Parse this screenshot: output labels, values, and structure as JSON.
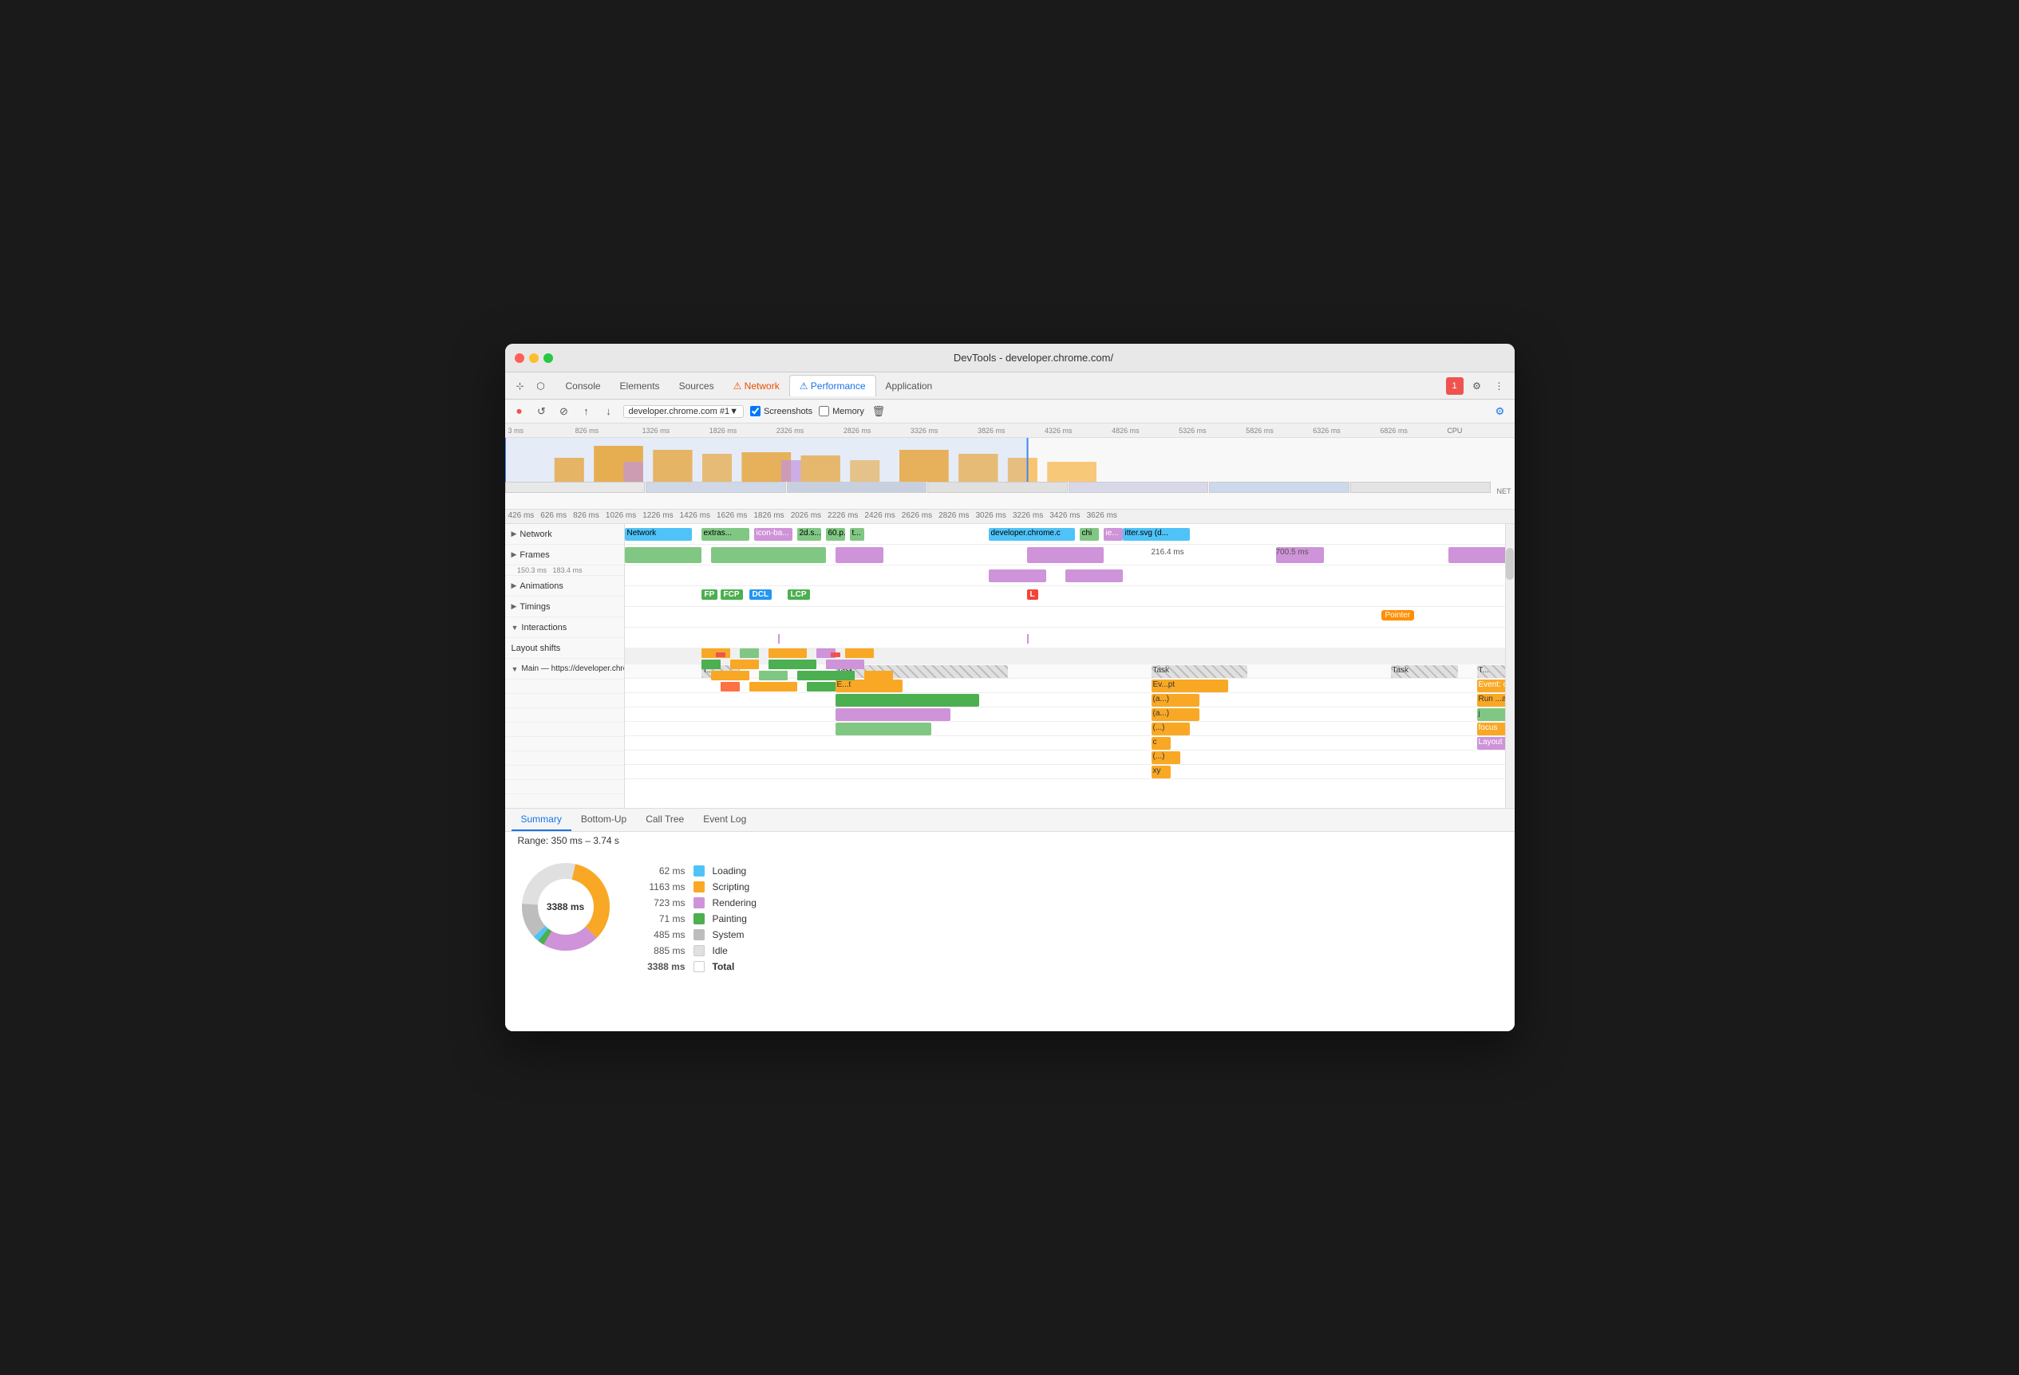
{
  "window": {
    "title": "DevTools - developer.chrome.com/"
  },
  "titlebar": {
    "traffic_lights": [
      "red",
      "yellow",
      "green"
    ]
  },
  "tabs": [
    {
      "label": "Console",
      "active": false,
      "warning": false
    },
    {
      "label": "Elements",
      "active": false,
      "warning": false
    },
    {
      "label": "Sources",
      "active": false,
      "warning": false
    },
    {
      "label": "⚠ Network",
      "active": false,
      "warning": true
    },
    {
      "label": "⚠ Performance",
      "active": true,
      "warning": true
    },
    {
      "label": "Application",
      "active": false,
      "warning": false
    }
  ],
  "toolbar": {
    "url": "developer.chrome.com #1▼",
    "screenshots_label": "Screenshots",
    "memory_label": "Memory"
  },
  "summary": {
    "range": "Range: 350 ms – 3.74 s",
    "total_ms": "3388 ms",
    "tabs": [
      "Summary",
      "Bottom-Up",
      "Call Tree",
      "Event Log"
    ],
    "active_tab": "Summary",
    "stats": [
      {
        "value": "62 ms",
        "label": "Loading",
        "color": "#4fc3f7"
      },
      {
        "value": "1163 ms",
        "label": "Scripting",
        "color": "#f9a825"
      },
      {
        "value": "723 ms",
        "label": "Rendering",
        "color": "#ce93d8"
      },
      {
        "value": "71 ms",
        "label": "Painting",
        "color": "#4caf50"
      },
      {
        "value": "485 ms",
        "label": "System",
        "color": "#bdbdbd"
      },
      {
        "value": "885 ms",
        "label": "Idle",
        "color": "#e0e0e0"
      },
      {
        "value": "3388 ms",
        "label": "Total",
        "color": "transparent",
        "bold": true
      }
    ]
  },
  "tracks": {
    "labels": [
      {
        "text": "Network",
        "arrow": "▶",
        "indent": 0
      },
      {
        "text": "Frames",
        "arrow": "▶",
        "indent": 0
      },
      {
        "text": "Animations",
        "arrow": "▶",
        "indent": 0
      },
      {
        "text": "Timings",
        "arrow": "▶",
        "indent": 0
      },
      {
        "text": "Interactions",
        "arrow": "▼",
        "indent": 0
      },
      {
        "text": "Layout shifts",
        "arrow": "",
        "indent": 0
      },
      {
        "text": "Main — https://developer.chrome.com/",
        "arrow": "▼",
        "indent": 0
      }
    ],
    "timings": [
      "FP",
      "FCP",
      "DCL",
      "LCP"
    ],
    "interactions": {
      "pointer": "Pointer"
    }
  },
  "overview_ticks": [
    "3 ms",
    "826 ms",
    "1326 ms",
    "1826 ms",
    "2326 ms",
    "2826 ms",
    "3326 ms",
    "3826 ms",
    "4326 ms",
    "4826 ms",
    "5326 ms",
    "5826 ms",
    "6326 ms",
    "6826 ms"
  ],
  "detail_ticks": [
    "426 ms",
    "626 ms",
    "826 ms",
    "1026 ms",
    "1226 ms",
    "1426 ms",
    "1626 ms",
    "1826 ms",
    "2026 ms",
    "2226 ms",
    "2426 ms",
    "2626 ms",
    "2826 ms",
    "3026 ms",
    "3226 ms",
    "3426 ms",
    "3626 ms"
  ],
  "network_bars": [
    {
      "label": "Network",
      "color": "#4fc3f7",
      "left": "0%",
      "width": "7%"
    },
    {
      "label": "extras...",
      "color": "#81c784",
      "left": "8%",
      "width": "6%"
    },
    {
      "label": "icon-ba...",
      "color": "#ce93d8",
      "left": "15%",
      "width": "5%"
    },
    {
      "label": "2d.s...",
      "color": "#81c784",
      "left": "21%",
      "width": "3%"
    },
    {
      "label": "60.p...",
      "color": "#81c784",
      "left": "25%",
      "width": "2%"
    },
    {
      "label": "t...",
      "color": "#81c784",
      "left": "28%",
      "width": "2%"
    },
    {
      "label": "developer.chrome.c",
      "color": "#4fc3f7",
      "left": "38%",
      "width": "8%"
    },
    {
      "label": "chi",
      "color": "#81c784",
      "left": "47%",
      "width": "2%"
    },
    {
      "label": "ie...",
      "color": "#ce93d8",
      "left": "50%",
      "width": "2%"
    },
    {
      "label": "itter.svg (d...",
      "color": "#4fc3f7",
      "left": "53%",
      "width": "6%"
    }
  ],
  "flame_tasks": [
    {
      "label": "T...",
      "color": "#bdbdbd",
      "left": "10%",
      "width": "4%",
      "striped": true
    },
    {
      "label": "Task",
      "color": "#bdbdbd",
      "left": "22%",
      "width": "18%",
      "striped": true
    },
    {
      "label": "Task",
      "color": "#bdbdbd",
      "left": "55%",
      "width": "10%",
      "striped": true
    },
    {
      "label": "Task",
      "color": "#bdbdbd",
      "left": "80%",
      "width": "7%",
      "striped": true
    },
    {
      "label": "T...",
      "color": "#bdbdbd",
      "left": "89%",
      "width": "6%",
      "striped": true
    }
  ],
  "right_panel_tasks": [
    {
      "label": "Task",
      "color": "#bdbdbd"
    },
    {
      "label": "Event: click",
      "color": "#f9a825"
    },
    {
      "label": "Run ...asks",
      "color": "#f9a825"
    },
    {
      "label": "j",
      "color": "#81c784"
    },
    {
      "label": "focus",
      "color": "#f9a825"
    },
    {
      "label": "Layout",
      "color": "#ce93d8"
    }
  ]
}
